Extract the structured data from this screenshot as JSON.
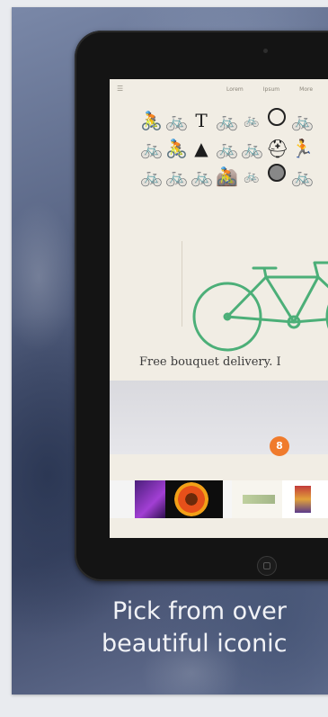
{
  "screen": {
    "menu_icon": "menu-icon",
    "nav": [
      "Lorem",
      "Ipsum",
      "More"
    ],
    "icon_rows": [
      [
        "🚴",
        "🚲",
        "T",
        "🚲",
        "🚲",
        "◉",
        "🚲"
      ],
      [
        "🚲",
        "🚴",
        "▲",
        "🚲",
        "🚲",
        "⛑",
        "🏃"
      ],
      [
        "🚲",
        "🚲",
        "🚲",
        "🚵",
        "🚲",
        "◉",
        "🚲"
      ]
    ],
    "tagline": "Free bouquet delivery. I",
    "accent_color": "#f07b2c",
    "badge_label": "8"
  },
  "caption": {
    "line1": "Pick from over",
    "line2": "beautiful iconic"
  },
  "colors": {
    "bike": "#4caf78",
    "accent": "#f07b2c"
  }
}
